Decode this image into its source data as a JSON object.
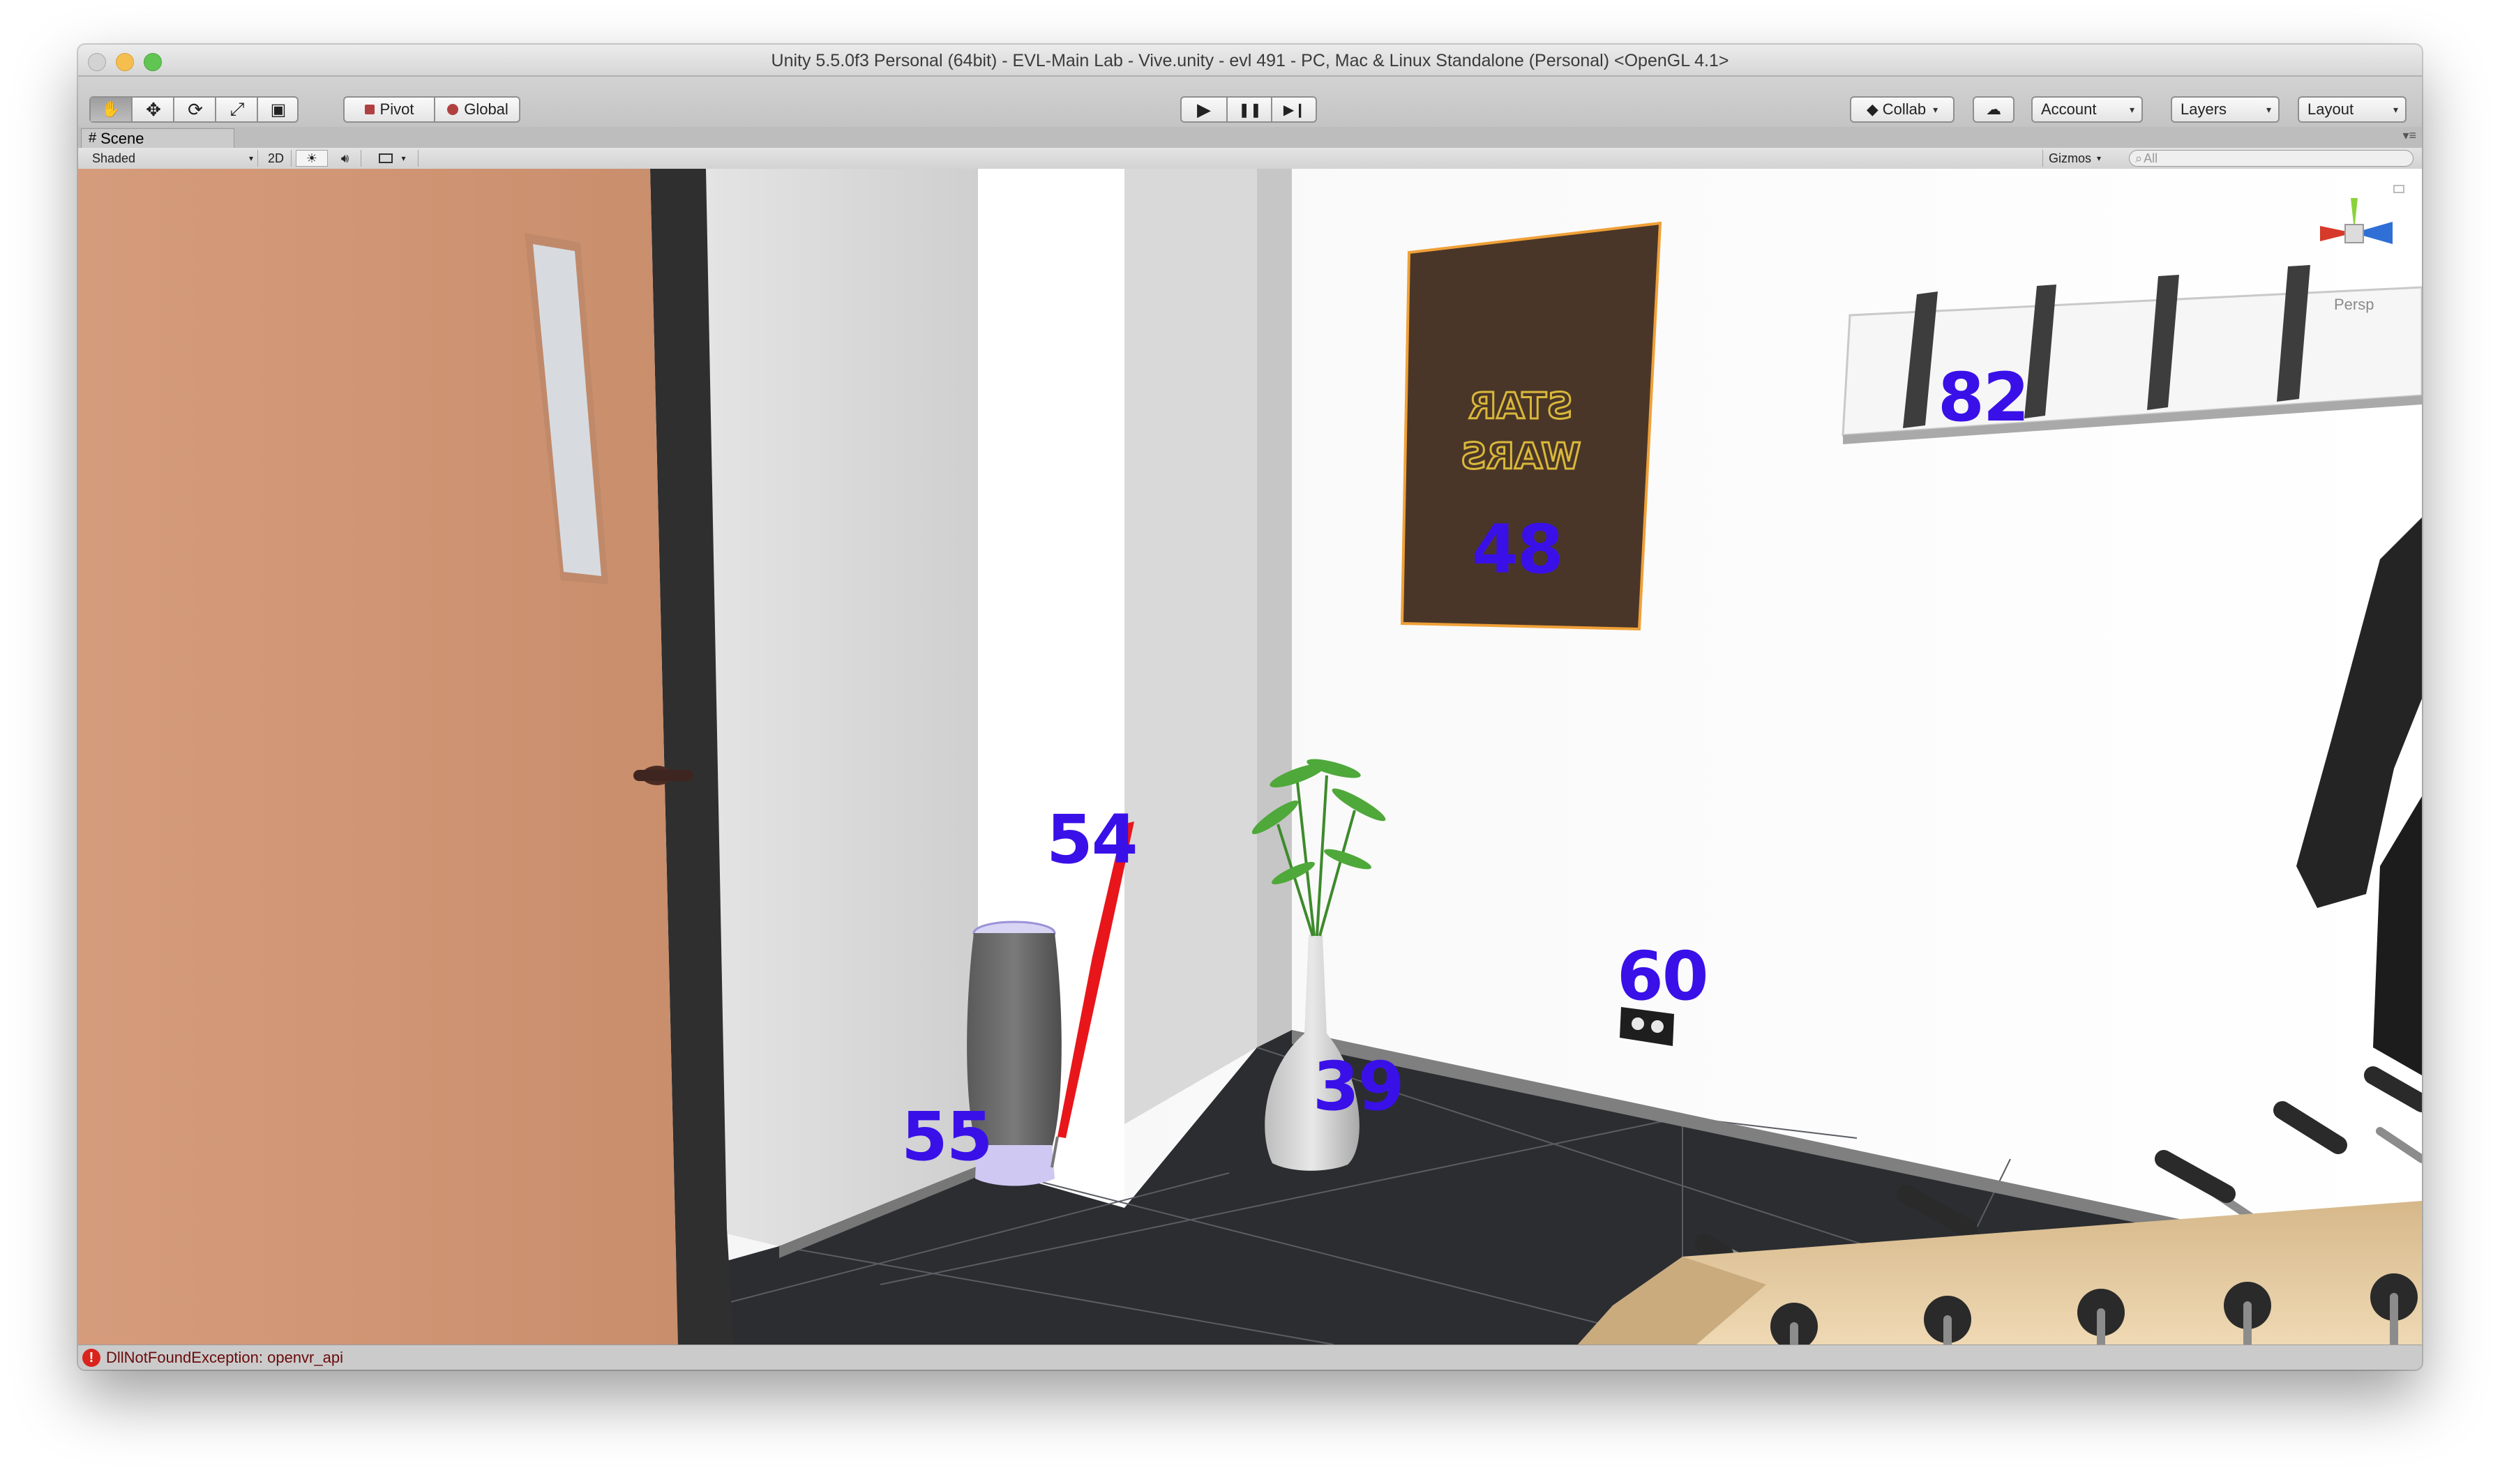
{
  "window": {
    "title": "Unity 5.5.0f3 Personal (64bit) - EVL-Main Lab - Vive.unity - evl 491 - PC, Mac & Linux Standalone (Personal) <OpenGL 4.1>"
  },
  "toolbar": {
    "tools": [
      {
        "name": "hand-tool",
        "icon": "hand-icon",
        "glyph": "✋"
      },
      {
        "name": "move-tool",
        "icon": "move-arrows-icon",
        "glyph": "✥"
      },
      {
        "name": "rotate-tool",
        "icon": "rotate-icon",
        "glyph": "⟳"
      },
      {
        "name": "scale-tool",
        "icon": "scale-icon",
        "glyph": "⤢"
      },
      {
        "name": "rect-tool",
        "icon": "rect-transform-icon",
        "glyph": "▣"
      }
    ],
    "pivot_label": "Pivot",
    "global_label": "Global",
    "play_glyph": "▶",
    "pause_glyph": "❚❚",
    "step_glyph": "▶❙",
    "collab_label": "Collab",
    "account_label": "Account",
    "layers_label": "Layers",
    "layout_label": "Layout"
  },
  "scene_tab": {
    "label": "Scene",
    "icon": "scene-grid-icon"
  },
  "scene_bar": {
    "shading_mode": "Shaded",
    "mode_2d_label": "2D",
    "gizmos_label": "Gizmos",
    "search_placeholder": "All"
  },
  "viewport": {
    "gizmo_label": "Persp",
    "labels": [
      {
        "id": "poster",
        "text": "48"
      },
      {
        "id": "coat-rack",
        "text": "82"
      },
      {
        "id": "umbrella",
        "text": "54"
      },
      {
        "id": "umbrella-stand",
        "text": "55"
      },
      {
        "id": "vase",
        "text": "39"
      },
      {
        "id": "outlet",
        "text": "60"
      }
    ],
    "label_color": "#3a10e8"
  },
  "status": {
    "message": "DllNotFoundException: openvr_api",
    "color": "#6a0b0b"
  }
}
